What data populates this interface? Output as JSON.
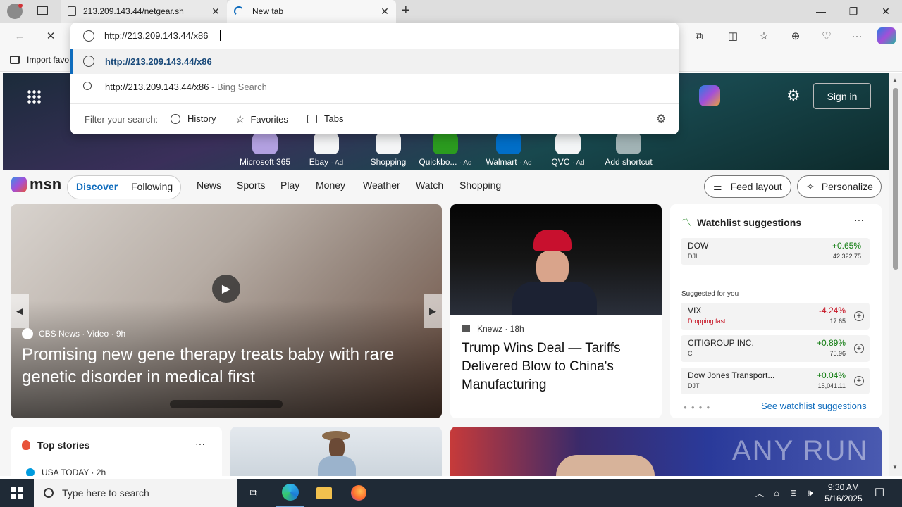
{
  "browser": {
    "tabs": [
      {
        "title": "213.209.143.44/netgear.sh"
      },
      {
        "title": "New tab"
      }
    ],
    "address": "http://213.209.143.44/x86",
    "favorites_bar": {
      "import_label": "Import favo"
    }
  },
  "omnibox": {
    "suggestions": [
      {
        "text": "http://213.209.143.44/x86",
        "kind": "url"
      },
      {
        "text": "http://213.209.143.44/x86",
        "suffix": "- Bing Search",
        "kind": "search"
      }
    ],
    "filter_label": "Filter your search:",
    "filters": [
      "History",
      "Favorites",
      "Tabs"
    ]
  },
  "newtab": {
    "sign_in": "Sign in",
    "shortcuts": [
      {
        "label": "Microsoft 365",
        "ad": ""
      },
      {
        "label": "Ebay",
        "ad": "· Ad"
      },
      {
        "label": "Shopping",
        "ad": ""
      },
      {
        "label": "Quickbo...",
        "ad": "· Ad"
      },
      {
        "label": "Walmart",
        "ad": "· Ad"
      },
      {
        "label": "QVC",
        "ad": "· Ad"
      },
      {
        "label": "Add shortcut",
        "ad": ""
      }
    ],
    "brand": "msn",
    "nav": {
      "discover": "Discover",
      "following": "Following",
      "links": [
        "News",
        "Sports",
        "Play",
        "Money",
        "Weather",
        "Watch",
        "Shopping"
      ]
    },
    "feed_layout": "Feed layout",
    "personalize": "Personalize"
  },
  "hero_story": {
    "source": "CBS News · Video · 9h",
    "headline": "Promising new gene therapy treats baby with rare genetic disorder in medical first"
  },
  "second_story": {
    "source": "Knewz · 18h",
    "headline": "Trump Wins Deal — Tariffs Delivered Blow to China's Manufacturing"
  },
  "watchlist": {
    "title": "Watchlist suggestions",
    "top": {
      "name": "DOW",
      "ticker": "DJI",
      "change": "+0.65%",
      "price": "42,322.75"
    },
    "suggested_label": "Suggested for you",
    "items": [
      {
        "name": "VIX",
        "ticker": "Dropping fast",
        "change": "-4.24%",
        "price": "17.65",
        "dir": "down"
      },
      {
        "name": "CITIGROUP INC.",
        "ticker": "C",
        "change": "+0.89%",
        "price": "75.96",
        "dir": "up"
      },
      {
        "name": "Dow Jones Transport...",
        "ticker": "DJT",
        "change": "+0.04%",
        "price": "15,041.11",
        "dir": "up"
      }
    ],
    "see_more": "See watchlist suggestions"
  },
  "top_stories": {
    "title": "Top stories",
    "first_source": "USA TODAY · 2h"
  },
  "watermark": "ANY RUN",
  "taskbar": {
    "search_placeholder": "Type here to search",
    "time": "9:30 AM",
    "date": "5/16/2025"
  },
  "colors": {
    "accent": "#0f6cbd",
    "positive": "#107c10",
    "negative": "#c50f1f",
    "taskbar": "#1f2a36"
  }
}
